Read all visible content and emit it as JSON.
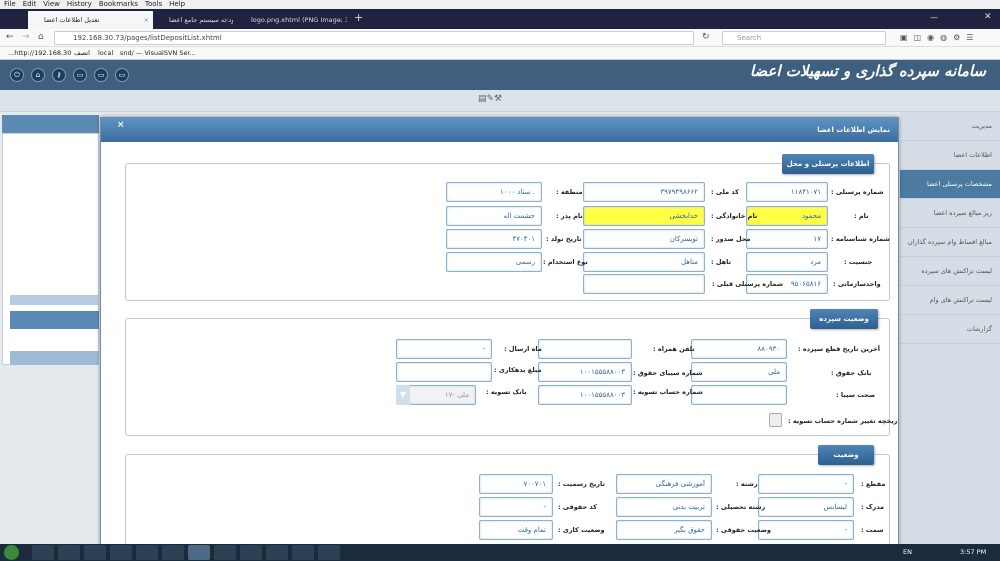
{
  "menu": [
    "File",
    "Edit",
    "View",
    "History",
    "Bookmarks",
    "Tools",
    "Help"
  ],
  "tabs": [
    {
      "label": "تعدیل اطلاعات اعضا"
    },
    {
      "label": "ورود به سیستم جامع اعضا"
    },
    {
      "label": "logo.png.xhtml (PNG Image, 3"
    }
  ],
  "nav": {
    "url": "192.168.30.73/pages/listDepositList.xhtml",
    "search_placeholder": "Search",
    "zoom": "..."
  },
  "bookmarks": [
    "...http://192.168.30",
    "اتصف",
    "local",
    "snd/ — VisualSVN Ser..."
  ],
  "app": {
    "title": "سامانه سپرده گذاری و تسهیلات اعضا",
    "sidebar": [
      "مدیریت",
      "اطلاعات اعضا",
      "مشخصات پرسنلی اعضا",
      "ریز مبالغ سپرده اعضا",
      "مبالغ اقساط وام سپرده گذاران",
      "لیست تراکنش های سپرده",
      "لیست تراکنش های وام",
      "گزارشات"
    ]
  },
  "modal": {
    "title": "نمایش اطلاعات اعضا",
    "close": "×",
    "s1": {
      "legend": "اطلاعات پرسنلی و محل خدمت",
      "labels": {
        "pid": "شماره پرسنلی :",
        "nid": "کد ملی :",
        "region": "منطقه :",
        "name": "نام :",
        "family": "نام خانوادگی :",
        "father": "نام پدر :",
        "idno": "شماره شناسنامه :",
        "issue": "محل صدور :",
        "birth": "تاریخ تولد :",
        "gender": "جنسیت :",
        "marital": "تاهل :",
        "emptype": "نوع استخدام :",
        "unit": "واحدسازمانی :",
        "prevpid": "شماره پرسنلی قبلی :"
      },
      "values": {
        "pid": "۱۱۸۴۱۰۷۱",
        "nid": "۳۹۷۹۴۹۸۶۶۲",
        "region": "۱۰۰۰ ستاد .",
        "name": "محمود",
        "family": "خدابخشی",
        "father": "حشمت اله",
        "idno": "۱۷",
        "issue": "تویسرکان",
        "birth": "۴۷۰۴۰۱",
        "gender": "مرد",
        "marital": "متاهل",
        "emptype": "رسمی",
        "unit": "۹۵۰۶۵۸۱۶",
        "prevpid": ""
      }
    },
    "s2": {
      "legend": "وضعیت سپرده گذاری",
      "labels": {
        "lastdate": "آخرین تاریخ قطع سپرده :",
        "mobile": "تلفن همراه :",
        "sendmonth": "ماه ارسال :",
        "bank": "بانک حقوق :",
        "sepa": "شماره سیبای حقوق :",
        "debt": "مبلغ بدهکاری :",
        "sepaok": "صحت سیبا :",
        "settleacc": "شماره حساب تسویه :",
        "settlebank": "بانک تسویه :",
        "history": "تاریخچه تغییر شماره حساب تسویه :"
      },
      "values": {
        "lastdate": "۸۸۰۹۳۰",
        "mobile": "",
        "sendmonth": "-",
        "bank": "ملی",
        "sepa": "۱۰۰۱۵۵۵۸۸۰۰۳",
        "debt": "",
        "sepaok": "",
        "settleacc": "۱۰۰۱۵۵۵۸۸۰۰۳",
        "settlebank": "۱۷- ملی"
      }
    },
    "s3": {
      "legend": "وضعیت استخدامی",
      "labels": {
        "grade": "مقطع :",
        "field": "رشته :",
        "officialdate": "تاریخ رسمیت :",
        "degree": "مدرک :",
        "edufield": "رشته تحصیلی :",
        "salarycode": "کد حقوقی :",
        "post": "سمت :",
        "salarystatus": "وضعیت حقوقی :",
        "workstatus": "وضعیت کاری :"
      },
      "values": {
        "grade": "-",
        "field": "آموزشی فرهنگی",
        "officialdate": "۷۰۰۷۰۱",
        "degree": "لیسانس",
        "edufield": "تربیت بدنی",
        "salarycode": "-",
        "post": "-",
        "salarystatus": "حقوق بگیر",
        "workstatus": "تمام وقت"
      }
    }
  },
  "taskbar": {
    "lang": "EN",
    "time": "3:57 PM"
  }
}
